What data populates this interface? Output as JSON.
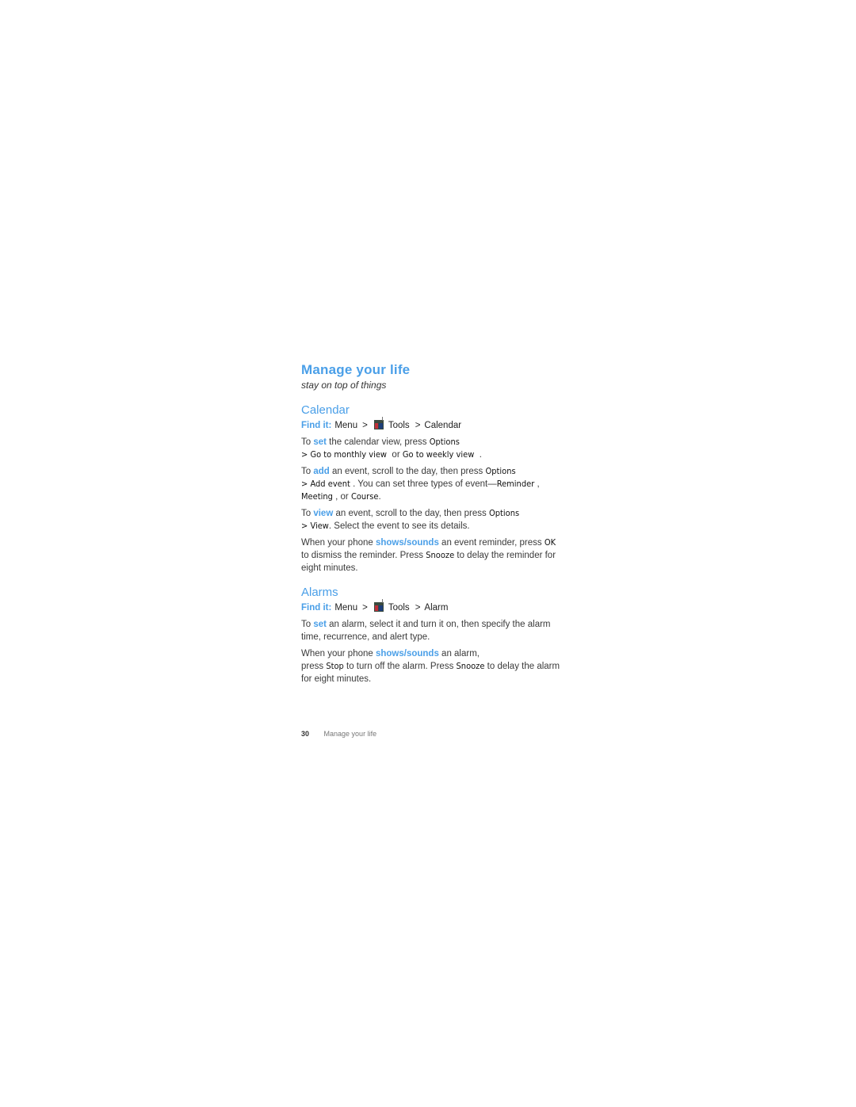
{
  "chapter": {
    "title": "Manage your life",
    "subtitle": "stay on top of things"
  },
  "calendar": {
    "heading": "Calendar",
    "find_it": {
      "label": "Find it:",
      "path": [
        "Menu",
        "Tools",
        "Calendar"
      ],
      "separator": ">",
      "icon": "tools-icon"
    },
    "set_para": {
      "pre": "To ",
      "keyword": "set",
      "text1": " the calendar view, press ",
      "ui1": "Options",
      "sep": "> ",
      "ui2": "Go to monthly view",
      "text2": "  or ",
      "ui3": "Go to weekly view",
      "end": "  ."
    },
    "add_para": {
      "pre": "To ",
      "keyword": "add",
      "text1": " an event, scroll to the day, then press ",
      "ui1": "Options",
      "sep": "> ",
      "ui2": "Add event",
      "text2": " . You can set three types of event—",
      "ui3": "Reminder",
      "text3": " , ",
      "ui4": "Meeting",
      "text4": " , or ",
      "ui5": "Course",
      "end": "."
    },
    "view_para": {
      "pre": "To ",
      "keyword": "view",
      "text1": " an event, scroll to the day, then press ",
      "ui1": "Options",
      "sep": "> ",
      "ui2": "View",
      "text2": ". Select the event to see its details."
    },
    "reminder_para": {
      "pre": "When your phone ",
      "keyword": "shows/sounds",
      "text1": " an event reminder, press ",
      "ui1": "OK",
      "text2": " to dismiss the reminder. Press ",
      "ui2": "Snooze",
      "text3": " to delay the reminder for eight minutes."
    }
  },
  "alarms": {
    "heading": "Alarms",
    "find_it": {
      "label": "Find it:",
      "path": [
        "Menu",
        "Tools",
        "Alarm"
      ],
      "separator": ">",
      "icon": "tools-icon"
    },
    "set_para": {
      "pre": "To ",
      "keyword": "set",
      "text1": " an alarm, select it and turn it on, then specify the alarm time, recurrence, and alert type."
    },
    "sound_para": {
      "pre": "When your phone ",
      "keyword": "shows/sounds",
      "text1": " an alarm,",
      "text2": "press ",
      "ui1": "Stop",
      "text3": " to turn off the alarm. Press ",
      "ui2": "Snooze",
      "text4": " to delay the alarm for eight minutes."
    }
  },
  "footer": {
    "page_number": "30",
    "section_name": "Manage your life"
  },
  "colors": {
    "accent": "#4a9fe8",
    "body_text": "#3a3a3a"
  }
}
